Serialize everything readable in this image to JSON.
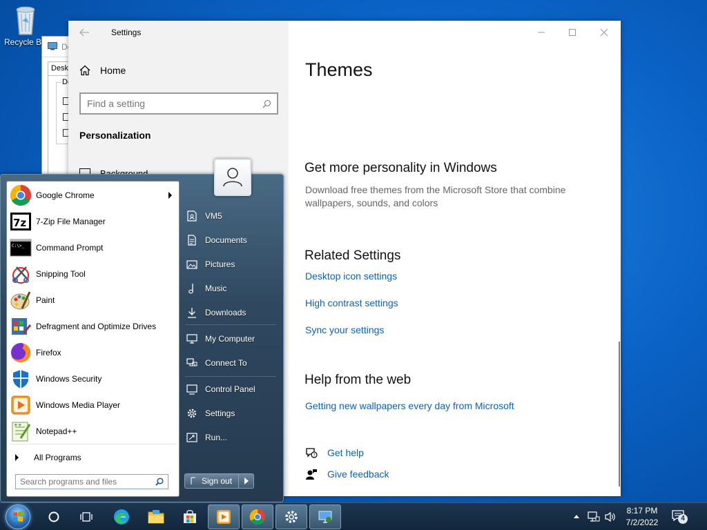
{
  "desktop": {
    "recycle_label": "Recycle Bin"
  },
  "bg_window": {
    "title": "Desktop Icon Settings",
    "tab": "Desktop Icons",
    "group": "Desktop icons"
  },
  "settings": {
    "window_title": "Settings",
    "home_label": "Home",
    "search_placeholder": "Find a setting",
    "section_label": "Personalization",
    "partial_item": "Background",
    "page_title": "Themes",
    "personality_heading": "Get more personality in Windows",
    "personality_desc": "Download free themes from the Microsoft Store that combine wallpapers, sounds, and colors",
    "related_heading": "Related Settings",
    "related_links": [
      "Desktop icon settings",
      "High contrast settings",
      "Sync your settings"
    ],
    "help_heading": "Help from the web",
    "help_link": "Getting new wallpapers every day from Microsoft",
    "get_help": "Get help",
    "give_feedback": "Give feedback"
  },
  "start_menu": {
    "programs": [
      {
        "label": "Google Chrome",
        "icon": "chrome-icon",
        "has_submenu": true
      },
      {
        "label": "7-Zip File Manager",
        "icon": "7zip-icon"
      },
      {
        "label": "Command Prompt",
        "icon": "cmd-icon"
      },
      {
        "label": "Snipping Tool",
        "icon": "snipping-tool-icon"
      },
      {
        "label": "Paint",
        "icon": "paint-icon"
      },
      {
        "label": "Defragment and Optimize Drives",
        "icon": "defrag-icon"
      },
      {
        "label": "Firefox",
        "icon": "firefox-icon"
      },
      {
        "label": "Windows Security",
        "icon": "shield-icon"
      },
      {
        "label": "Windows Media Player",
        "icon": "media-player-icon"
      },
      {
        "label": "Notepad++",
        "icon": "notepadpp-icon"
      }
    ],
    "all_programs": "All Programs",
    "search_placeholder": "Search programs and files",
    "right_items": [
      "VM5",
      "Documents",
      "Pictures",
      "Music",
      "Downloads",
      "My Computer",
      "Connect To",
      "Control Panel",
      "Settings",
      "Run..."
    ],
    "signout_label": "Sign out"
  },
  "taskbar": {
    "time": "8:17 PM",
    "date": "7/2/2022",
    "notification_count": "4",
    "apps": [
      "start-orb",
      "cortana-icon",
      "task-view-icon",
      "edge-icon",
      "file-explorer-icon",
      "store-icon",
      "media-player-icon",
      "chrome-icon",
      "settings-gear-icon",
      "display-settings-icon"
    ]
  }
}
